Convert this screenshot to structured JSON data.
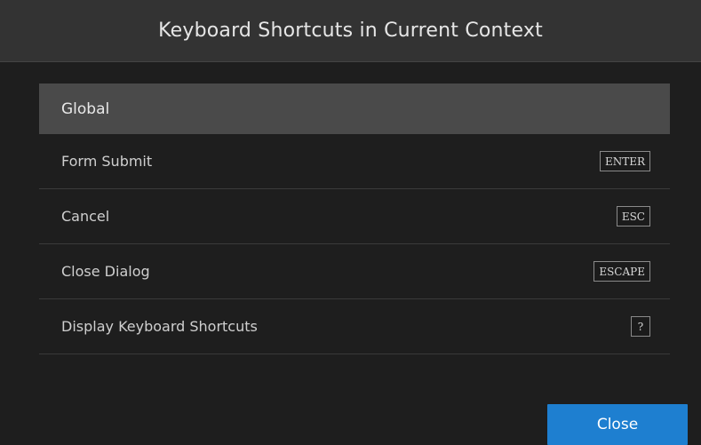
{
  "dialog": {
    "title": "Keyboard Shortcuts in Current Context",
    "close_label": "Close"
  },
  "group": {
    "title": "Global",
    "shortcuts": [
      {
        "label": "Form Submit",
        "key": "ENTER"
      },
      {
        "label": "Cancel",
        "key": "ESC"
      },
      {
        "label": "Close Dialog",
        "key": "ESCAPE"
      },
      {
        "label": "Display Keyboard Shortcuts",
        "key": "?"
      }
    ]
  },
  "colors": {
    "header_bg": "#333333",
    "body_bg": "#1e1e1e",
    "group_header_bg": "#4a4a4a",
    "accent": "#1e7fd0"
  }
}
